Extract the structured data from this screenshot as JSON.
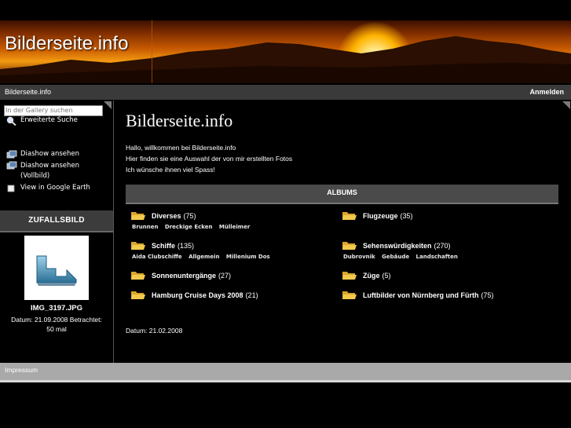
{
  "header": {
    "site_title": "Bilderseite.info"
  },
  "topbar": {
    "home_link": "Bilderseite.info",
    "login": "Anmelden"
  },
  "sidebar": {
    "search_placeholder": "In der Gallery suchen",
    "advanced_search": "Erweiterte Suche",
    "slideshow": "Diashow ansehen",
    "slideshow_full_line1": "Diashow ansehen",
    "slideshow_full_line2": "(Vollbild)",
    "google_earth": "View in Google Earth",
    "random_heading": "ZUFALLSBILD",
    "random_image": {
      "name": "IMG_3197.JPG",
      "info_line1": "Datum: 21.09.2008 Betrachtet:",
      "info_line2": "50 mal"
    }
  },
  "main": {
    "title": "Bilderseite.info",
    "intro": [
      "Hallo, willkommen bei Bilderseite.info",
      "Hier finden sie eine Auswahl der von mir erstellten Fotos",
      "Ich wünsche ihnen viel Spass!"
    ],
    "albums_heading": "ALBUMS",
    "albums": [
      {
        "name": "Diverses",
        "count": "(75)",
        "subs": [
          "Brunnen",
          "Dreckige Ecken",
          "Mülleimer"
        ]
      },
      {
        "name": "Flugzeuge",
        "count": "(35)",
        "subs": []
      },
      {
        "name": "Schiffe",
        "count": "(135)",
        "subs": [
          "Aida Clubschiffe",
          "Allgemein",
          "Millenium Dos"
        ]
      },
      {
        "name": "Sehenswürdigkeiten",
        "count": "(270)",
        "subs": [
          "Dubrovnik",
          "Gebäude",
          "Landschaften"
        ]
      },
      {
        "name": "Sonnenuntergänge",
        "count": "(27)",
        "subs": []
      },
      {
        "name": "Züge",
        "count": "(5)",
        "subs": []
      },
      {
        "name": "Hamburg Cruise Days 2008",
        "count": "(21)",
        "subs": []
      },
      {
        "name": "Luftbilder von Nürnberg und Fürth",
        "count": "(75)",
        "subs": []
      }
    ],
    "date": "Datum: 21.02.2008"
  },
  "footer": {
    "impressum": "Impressum"
  },
  "colors": {
    "folder": "#f2c94c",
    "panel": "#3a3a3a",
    "footer": "#a9a9a9"
  }
}
